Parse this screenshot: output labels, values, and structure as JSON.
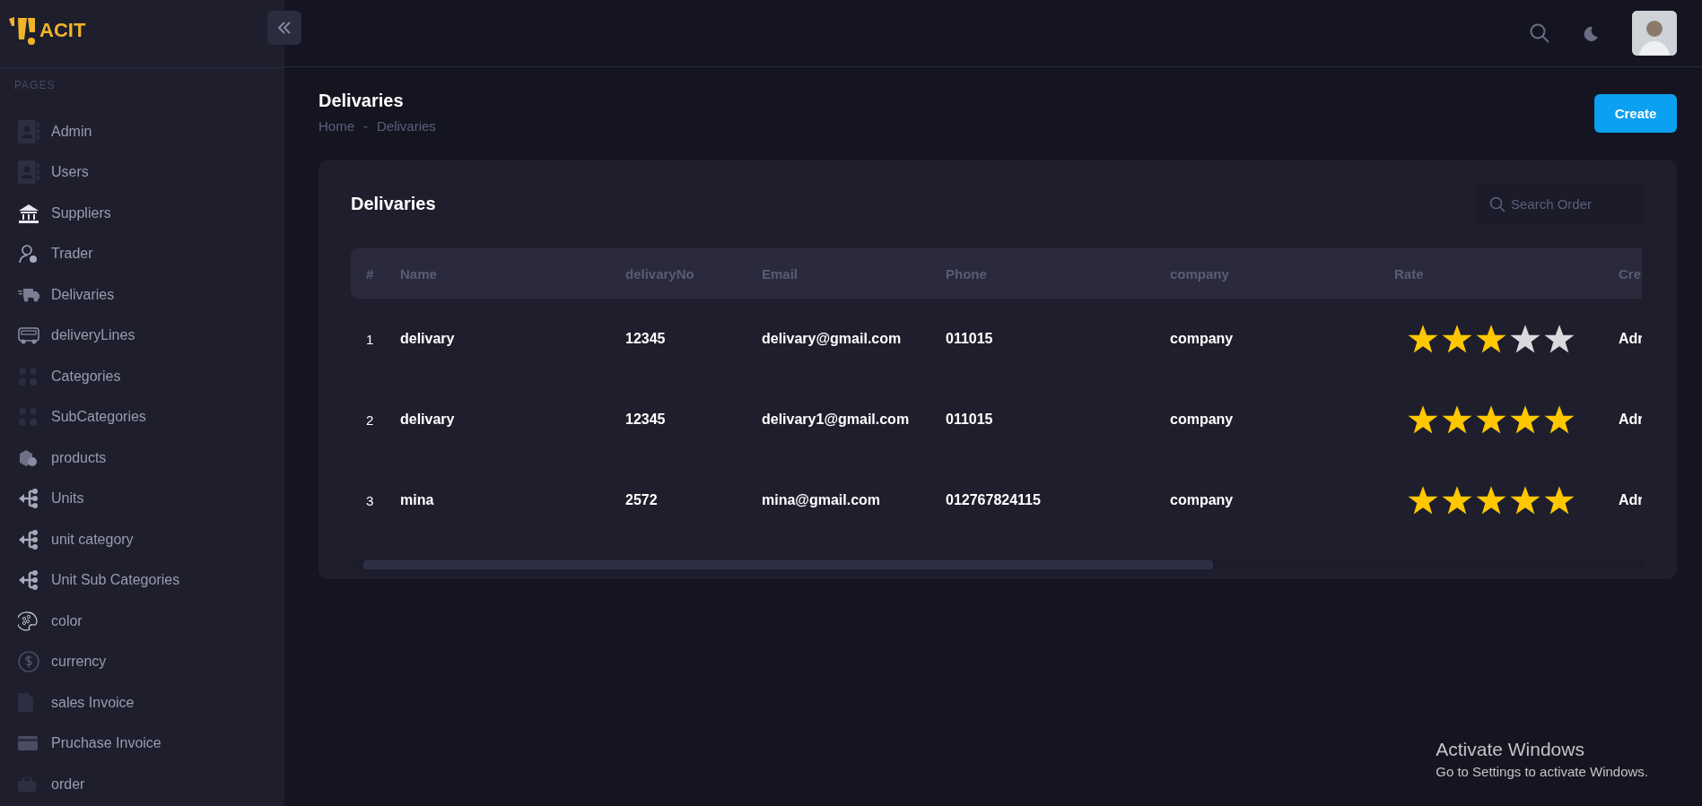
{
  "brand": {
    "name": "ACIT"
  },
  "sidebar": {
    "section": "PAGES",
    "items": [
      {
        "label": "Admin",
        "selected": false
      },
      {
        "label": "Users",
        "selected": false
      },
      {
        "label": "Suppliers",
        "selected": false
      },
      {
        "label": "Trader",
        "selected": false
      },
      {
        "label": "Delivaries",
        "selected": false
      },
      {
        "label": "deliveryLines",
        "selected": false
      },
      {
        "label": "Categories",
        "selected": false
      },
      {
        "label": "SubCategories",
        "selected": false
      },
      {
        "label": "products",
        "selected": false
      },
      {
        "label": "Units",
        "selected": false
      },
      {
        "label": "unit category",
        "selected": false
      },
      {
        "label": "Unit Sub Categories",
        "selected": false
      },
      {
        "label": "color",
        "selected": false
      },
      {
        "label": "currency",
        "selected": false
      },
      {
        "label": "sales Invoice",
        "selected": false
      },
      {
        "label": "Pruchase Invoice",
        "selected": false
      },
      {
        "label": "order",
        "selected": false
      }
    ]
  },
  "page": {
    "title": "Delivaries",
    "breadcrumb": [
      "Home",
      "Delivaries"
    ],
    "breadcrumb_separator": "-",
    "create_button": "Create"
  },
  "card": {
    "title": "Delivaries",
    "search": {
      "placeholder": "Search Order"
    },
    "table": {
      "columns": [
        "#",
        "Name",
        "delivaryNo",
        "Email",
        "Phone",
        "company",
        "Rate",
        "Cre"
      ],
      "rows": [
        {
          "cells": [
            "1",
            "delivary",
            "12345",
            "delivary@gmail.com",
            "011015",
            "company",
            "Adr"
          ],
          "stars": 3
        },
        {
          "cells": [
            "2",
            "delivary",
            "12345",
            "delivary1@gmail.com",
            "011015",
            "company",
            "Adr"
          ],
          "stars": 5
        },
        {
          "cells": [
            "3",
            "mina",
            "2572",
            "mina@gmail.com",
            "012767824115",
            "company",
            "Adr"
          ],
          "stars": 5
        }
      ]
    }
  },
  "os_notice": {
    "title": "Activate Windows",
    "text": "Go to Settings to activate Windows."
  }
}
